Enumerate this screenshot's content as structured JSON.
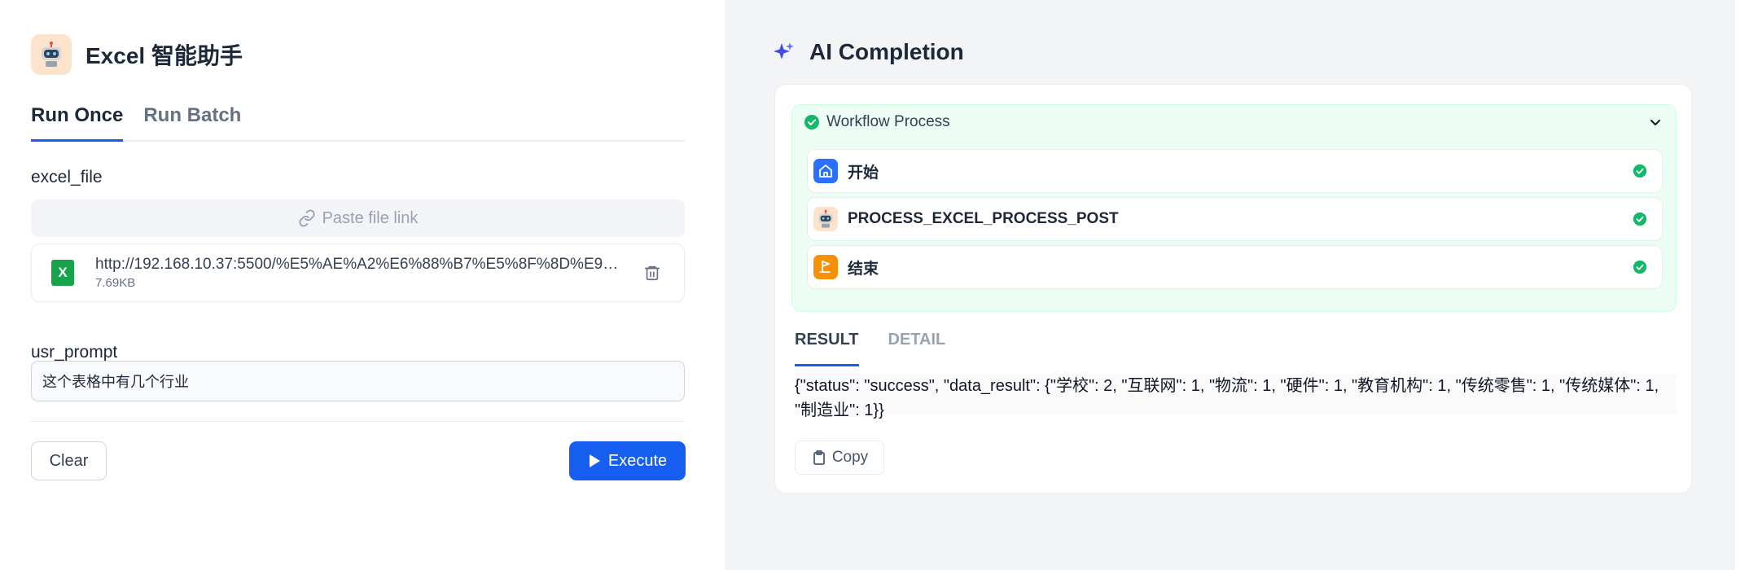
{
  "app": {
    "title": "Excel 智能助手",
    "icon": "robot-icon"
  },
  "tabs": [
    {
      "label": "Run Once",
      "active": true
    },
    {
      "label": "Run Batch",
      "active": false
    }
  ],
  "form": {
    "excel_file_label": "excel_file",
    "paste_link_placeholder": "Paste file link",
    "file": {
      "name": "http://192.168.10.37:5500/%E5%AE%A2%E6%88%B7%E5%8F%8D%E9%A6...",
      "size": "7.69KB",
      "icon": "excel-file-icon"
    },
    "usr_prompt_label": "usr_prompt",
    "usr_prompt_value": "这个表格中有几个行业"
  },
  "actions": {
    "clear_label": "Clear",
    "execute_label": "Execute"
  },
  "completion": {
    "title": "AI Completion",
    "workflow": {
      "title": "Workflow Process",
      "status": "success",
      "nodes": [
        {
          "label": "开始",
          "icon": "home-icon",
          "status": "success"
        },
        {
          "label": "PROCESS_EXCEL_PROCESS_POST",
          "icon": "robot-icon",
          "status": "success"
        },
        {
          "label": "结束",
          "icon": "flag-icon",
          "status": "success"
        }
      ]
    },
    "result_tabs": [
      {
        "label": "RESULT",
        "active": true
      },
      {
        "label": "DETAIL",
        "active": false
      }
    ],
    "result_text": "{\"status\": \"success\", \"data_result\": {\"学校\": 2, \"互联网\": 1, \"物流\": 1, \"硬件\": 1, \"教育机构\": 1, \"传统零售\": 1, \"传统媒体\": 1, \"制造业\": 1}}",
    "copy_label": "Copy"
  },
  "colors": {
    "accent": "#155eef",
    "success": "#12b76a",
    "workflow_bg": "#ecfdf3",
    "right_panel_bg": "#f3f4f6"
  }
}
